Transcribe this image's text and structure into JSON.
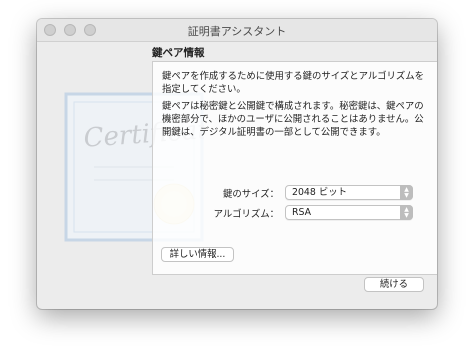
{
  "window": {
    "title": "証明書アシスタント"
  },
  "section": {
    "title": "鍵ペア情報"
  },
  "description": {
    "p1": "鍵ペアを作成するために使用する鍵のサイズとアルゴリズムを指定してください。",
    "p2": "鍵ペアは秘密鍵と公開鍵で構成されます。秘密鍵は、鍵ペアの機密部分で、ほかのユーザに公開されることはありません。公開鍵は、デジタル証明書の一部として公開できます。"
  },
  "fields": {
    "key_size": {
      "label": "鍵のサイズ：",
      "value": "2048 ビット"
    },
    "algorithm": {
      "label": "アルゴリズム：",
      "value": "RSA"
    }
  },
  "buttons": {
    "more_info": "詳しい情報...",
    "continue": "続ける"
  },
  "certificate": {
    "text": "Certificate"
  },
  "icons": {
    "stepper": "up-down-arrows-icon",
    "certificate": "certificate-icon"
  }
}
